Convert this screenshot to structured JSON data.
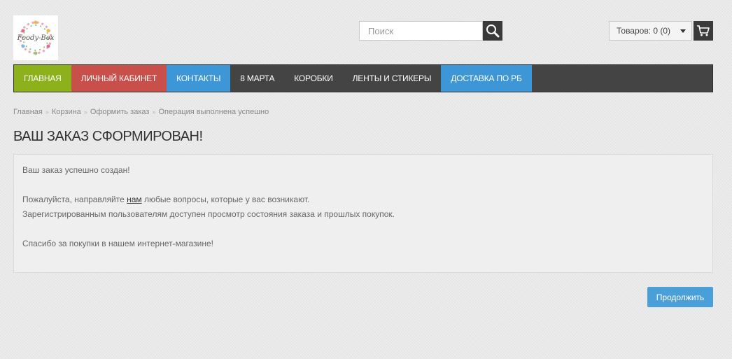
{
  "logo": {
    "text": "Foody-Box"
  },
  "search": {
    "placeholder": "Поиск"
  },
  "cart": {
    "label": "Товаров: 0 (0)"
  },
  "nav": {
    "items": [
      {
        "label": "ГЛАВНАЯ",
        "color": "#8cb11a"
      },
      {
        "label": "ЛИЧНЫЙ КАБИНЕТ",
        "color": "#c9504a"
      },
      {
        "label": "КОНТАКТЫ",
        "color": "#3d97d6"
      },
      {
        "label": "8 МАРТА",
        "color": "#444444"
      },
      {
        "label": "КОРОБКИ",
        "color": "#444444"
      },
      {
        "label": "ЛЕНТЫ И СТИКЕРЫ",
        "color": "#444444"
      },
      {
        "label": "ДОСТАВКА ПО РБ",
        "color": "#3d97d6"
      }
    ]
  },
  "breadcrumb": {
    "items": [
      "Главная",
      "Корзина",
      "Оформить заказ",
      "Операция выполнена успешно"
    ],
    "separator": "»"
  },
  "page": {
    "title": "ВАШ ЗАКАЗ СФОРМИРОВАН!",
    "line1": "Ваш заказ успешно создан!",
    "line2_before": "Пожалуйста, направляйте ",
    "line2_link": "нам",
    "line2_after": " любые вопросы, которые у вас возникают.",
    "line3": "Зарегистрированным пользователям доступен просмотр состояния заказа и прошлых покупок.",
    "line4": "Спасибо за покупки в нашем интернет-магазине!"
  },
  "buttons": {
    "continue": "Продолжить"
  },
  "colors": {
    "accent_blue": "#4a9fd8",
    "nav_dark": "#444444"
  }
}
